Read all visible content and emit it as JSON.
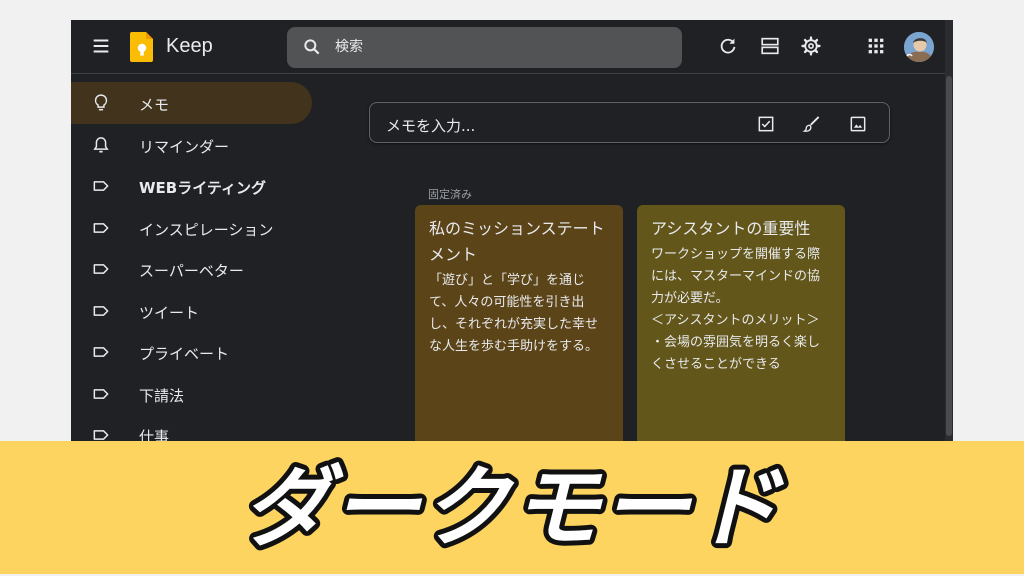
{
  "header": {
    "app_name": "Keep",
    "search_placeholder": "検索",
    "icons": [
      "hamburger-menu-icon",
      "keep-logo-icon",
      "search-icon",
      "refresh-icon",
      "list-view-icon",
      "settings-gear-icon",
      "apps-grid-icon",
      "avatar"
    ]
  },
  "sidebar": {
    "items": [
      {
        "label": "メモ",
        "icon": "lightbulb-icon",
        "active": true
      },
      {
        "label": "リマインダー",
        "icon": "bell-icon",
        "active": false
      },
      {
        "label": "WEBライティング",
        "icon": "label-icon",
        "active": false
      },
      {
        "label": "インスピレーション",
        "icon": "label-icon",
        "active": false
      },
      {
        "label": "スーパーベター",
        "icon": "label-icon",
        "active": false
      },
      {
        "label": "ツイート",
        "icon": "label-icon",
        "active": false
      },
      {
        "label": "プライベート",
        "icon": "label-icon",
        "active": false
      },
      {
        "label": "下請法",
        "icon": "label-icon",
        "active": false
      },
      {
        "label": "仕事",
        "icon": "label-icon",
        "active": false
      }
    ]
  },
  "main": {
    "take_note_placeholder": "メモを入力...",
    "pinned_label": "固定済み",
    "notes": [
      {
        "title": "私のミッションステートメント",
        "body": "「遊び」と「学び」を通じて、人々の可能性を引き出し、それぞれが充実した幸せな人生を歩む手助けをする。",
        "color": "#5c4419"
      },
      {
        "title": "アシスタントの重要性",
        "body": "ワークショップを開催する際には、マスターマインドの協力が必要だ。\n＜アシスタントのメリット＞\n・会場の雰囲気を明るく楽しくさせることができる",
        "color": "#63561b"
      }
    ]
  },
  "banner": {
    "text": "ダークモード",
    "background": "#fcd45f"
  },
  "colors": {
    "app_background": "#202124",
    "active_nav": "#41331c",
    "page_background": "#f1f1f1"
  }
}
